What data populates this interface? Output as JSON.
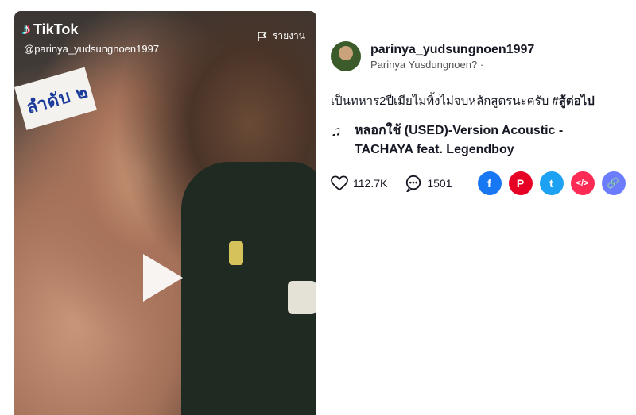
{
  "video": {
    "logo_text": "TikTok",
    "logo_icon": "tiktok-note-icon",
    "handle": "@parinya_yudsungnoen1997",
    "report_label": "รายงาน",
    "sign_text": "ลำดับ ๒"
  },
  "author": {
    "username": "parinya_yudsungnoen1997",
    "nickname": "Parinya Yusdungnoen? ·"
  },
  "description": {
    "text": "เป็นทหาร2ปีเมียไม่ทิ้งไม่จบหลักสูตรนะครับ ",
    "hashtag": "#สู้ต่อไป"
  },
  "music": {
    "line1": "หลอกใช้ (USED)-Version Acoustic -",
    "line2": "TACHAYA feat. Legendboy"
  },
  "stats": {
    "likes": "112.7K",
    "comments": "1501"
  },
  "share": {
    "facebook": {
      "glyph": "f",
      "color": "#1877f2"
    },
    "pinterest": {
      "glyph": "P",
      "color": "#e60023"
    },
    "twitter": {
      "glyph": "t",
      "color": "#1da1f2"
    },
    "embed": {
      "glyph": "</>",
      "color": "#fe2c55"
    },
    "link": {
      "glyph": "🔗",
      "color": "#6b7cff"
    }
  }
}
